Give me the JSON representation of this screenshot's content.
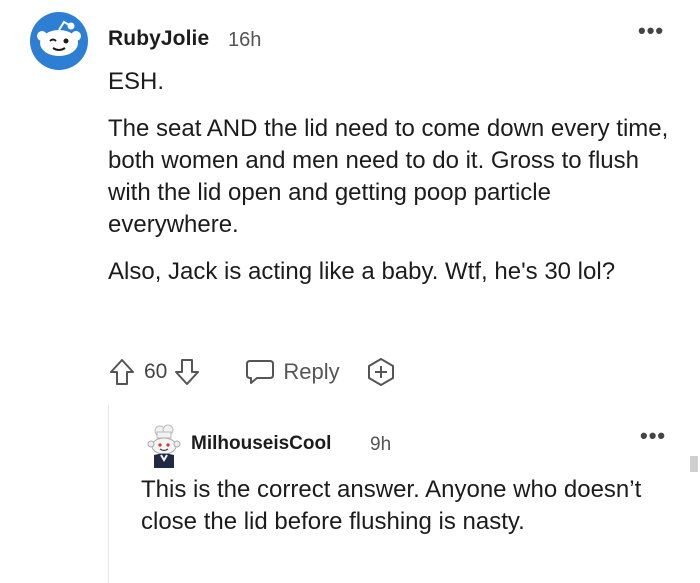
{
  "main_comment": {
    "username": "RubyJolie",
    "time": "16h",
    "more_label": "•••",
    "paragraphs": [
      "ESH.",
      "The seat AND the lid need to come down every time, both women and men need to do it. Gross to flush with the lid open and getting poop particle everywhere.",
      "Also, Jack is acting like a baby. Wtf, he's 30 lol?"
    ],
    "score": "60",
    "reply_label": "Reply",
    "avatar_icon": "snoo-winking-avatar-icon",
    "accent_color": "#2d7fd3"
  },
  "reply_comment": {
    "username": "MilhouseisCool",
    "time": "9h",
    "more_label": "•••",
    "text": "This is the correct answer. Anyone who doesn’t close the lid before flushing is nasty.",
    "avatar_icon": "snoo-chef-avatar-icon"
  },
  "icons": {
    "upvote": "upvote-arrow-icon",
    "downvote": "downvote-arrow-icon",
    "reply": "speech-bubble-icon",
    "award": "award-plus-icon"
  }
}
